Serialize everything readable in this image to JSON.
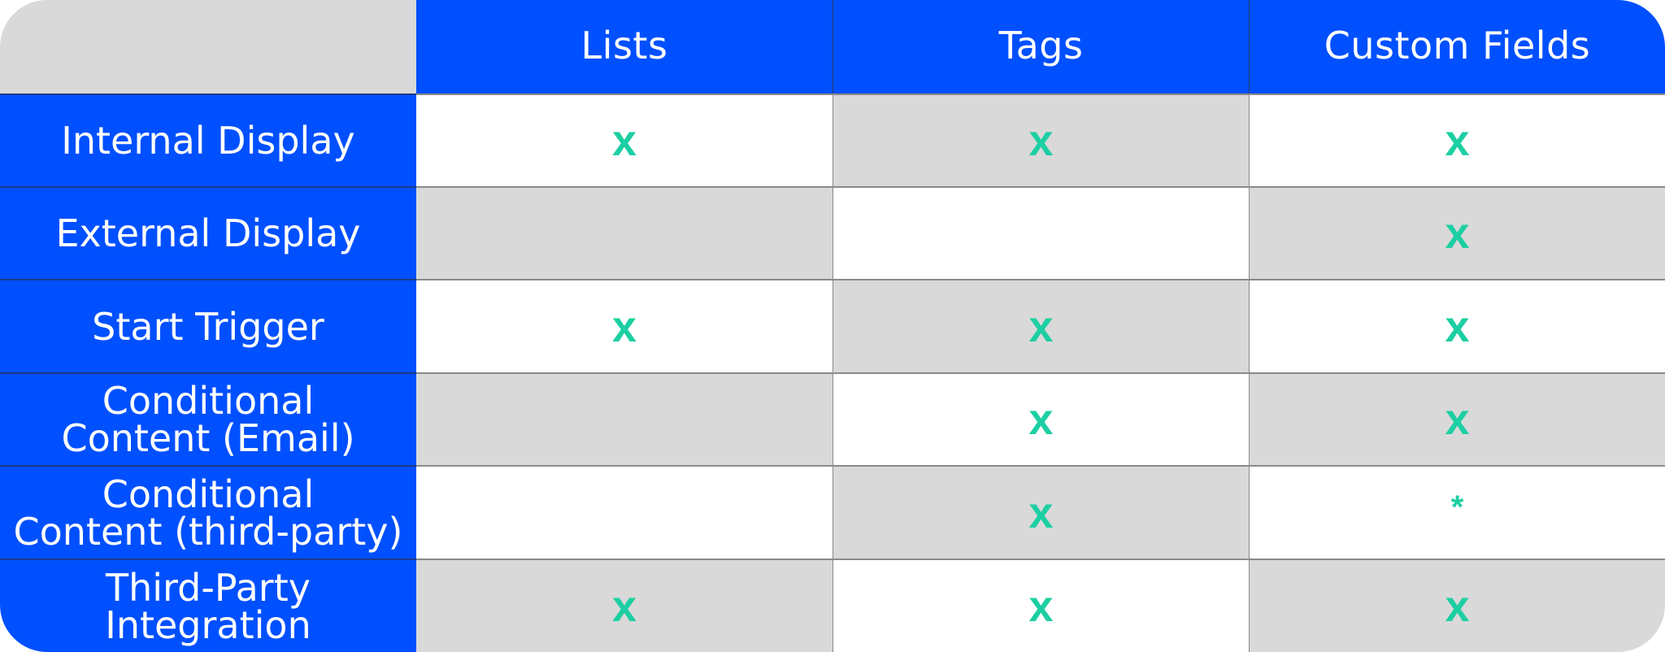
{
  "colors": {
    "header_blue": "#0050ff",
    "cell_gray": "#d9d9d9",
    "cell_white": "#ffffff",
    "check_green": "#1ccfa2"
  },
  "columns": [
    "Lists",
    "Tags",
    "Custom Fields"
  ],
  "rows": [
    {
      "label": "Internal Display",
      "values": [
        "x",
        "x",
        "x"
      ]
    },
    {
      "label": "External Display",
      "values": [
        "",
        "",
        "x"
      ]
    },
    {
      "label": "Start Trigger",
      "values": [
        "x",
        "x",
        "x"
      ]
    },
    {
      "label": "Conditional\nContent (Email)",
      "values": [
        "",
        "x",
        "x"
      ]
    },
    {
      "label": "Conditional\nContent (third-party)",
      "values": [
        "",
        "x",
        "*"
      ]
    },
    {
      "label": "Third-Party\nIntegration",
      "values": [
        "x",
        "x",
        "x"
      ]
    }
  ]
}
